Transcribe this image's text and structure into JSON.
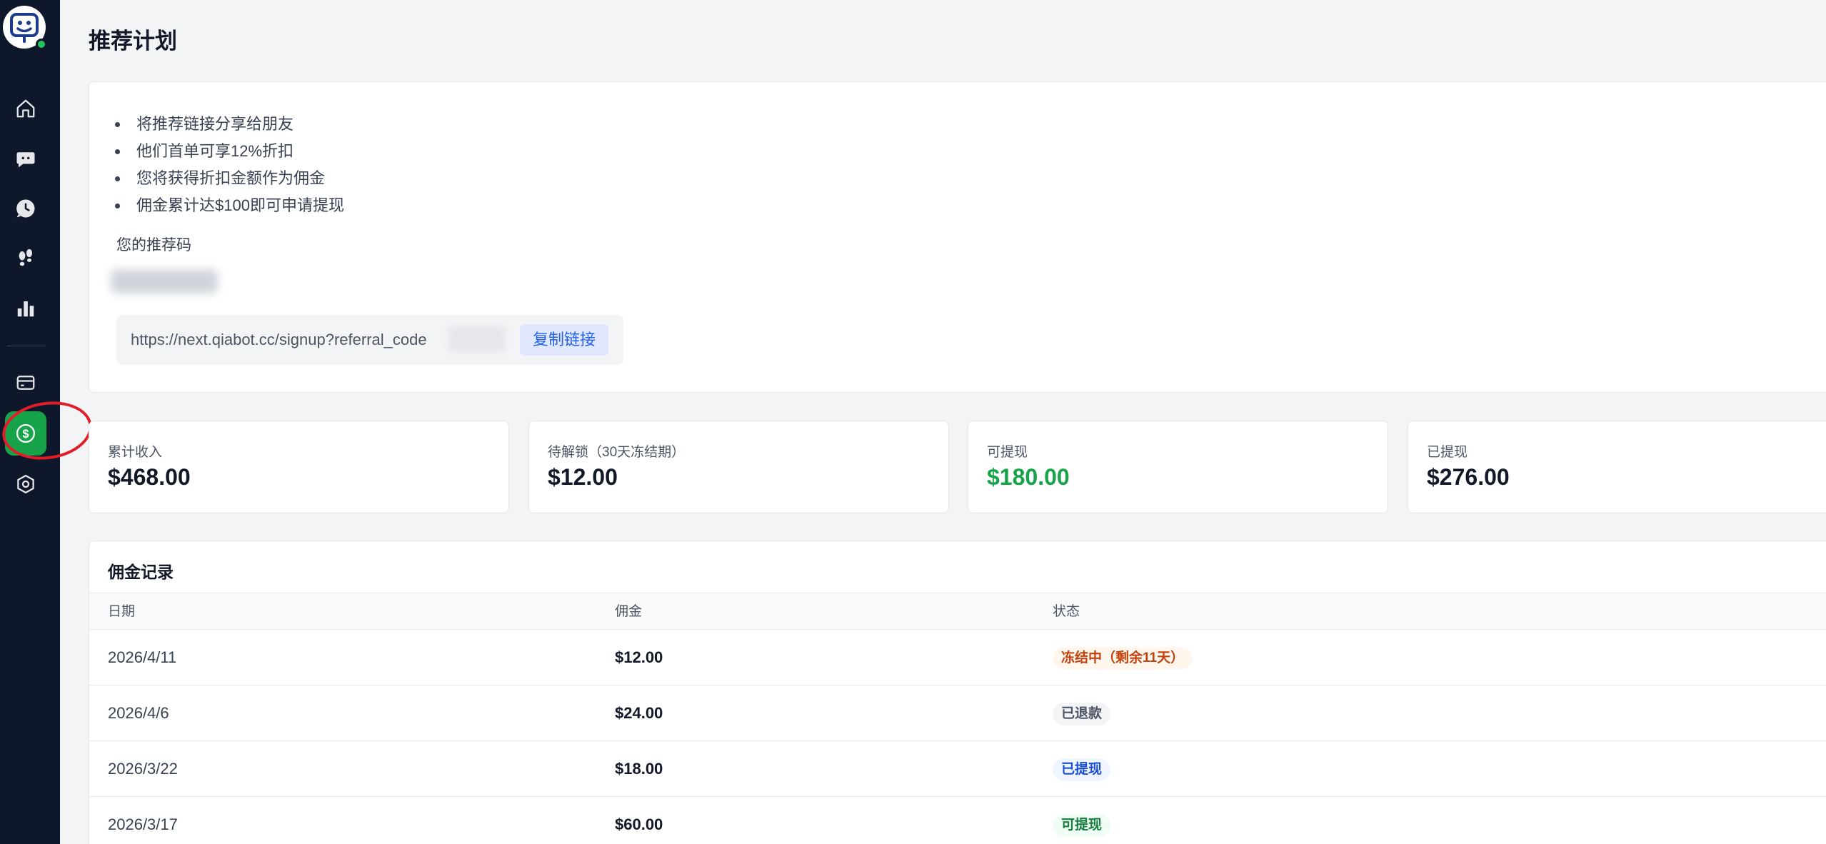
{
  "page": {
    "title": "推荐计划"
  },
  "sidebar": {
    "items": [
      {
        "icon": "home-icon"
      },
      {
        "icon": "chat-icon"
      },
      {
        "icon": "history-icon"
      },
      {
        "icon": "footprints-icon"
      },
      {
        "icon": "bar-chart-icon"
      },
      {
        "icon": "billing-card-icon"
      },
      {
        "icon": "dollar-circle-icon",
        "active": true
      },
      {
        "icon": "settings-hexagon-icon"
      }
    ],
    "accent_color": "#16a34a",
    "annotation_color": "#e11d2a"
  },
  "info": {
    "bullets": [
      "将推荐链接分享给朋友",
      "他们首单可享12%折扣",
      "您将获得折扣金额作为佣金",
      "佣金累计达$100即可申请提现"
    ],
    "code_label": "您的推荐码",
    "link_url": "https://next.qiabot.cc/signup?referral_code",
    "copy_button": "复制链接"
  },
  "stats": [
    {
      "label": "累计收入",
      "value": "$468.00"
    },
    {
      "label": "待解锁（30天冻结期）",
      "value": "$12.00"
    },
    {
      "label": "可提现",
      "value": "$180.00",
      "color": "#16a34a"
    },
    {
      "label": "已提现",
      "value": "$276.00"
    }
  ],
  "commissions": {
    "title": "佣金记录",
    "columns": [
      "日期",
      "佣金",
      "状态"
    ],
    "rows": [
      {
        "date": "2026/4/11",
        "amount": "$12.00",
        "status": "冻结中（剩余11天）",
        "status_type": "frozen"
      },
      {
        "date": "2026/4/6",
        "amount": "$24.00",
        "status": "已退款",
        "status_type": "refunded"
      },
      {
        "date": "2026/3/22",
        "amount": "$18.00",
        "status": "已提现",
        "status_type": "withdrawn"
      },
      {
        "date": "2026/3/17",
        "amount": "$60.00",
        "status": "可提现",
        "status_type": "available"
      }
    ]
  }
}
